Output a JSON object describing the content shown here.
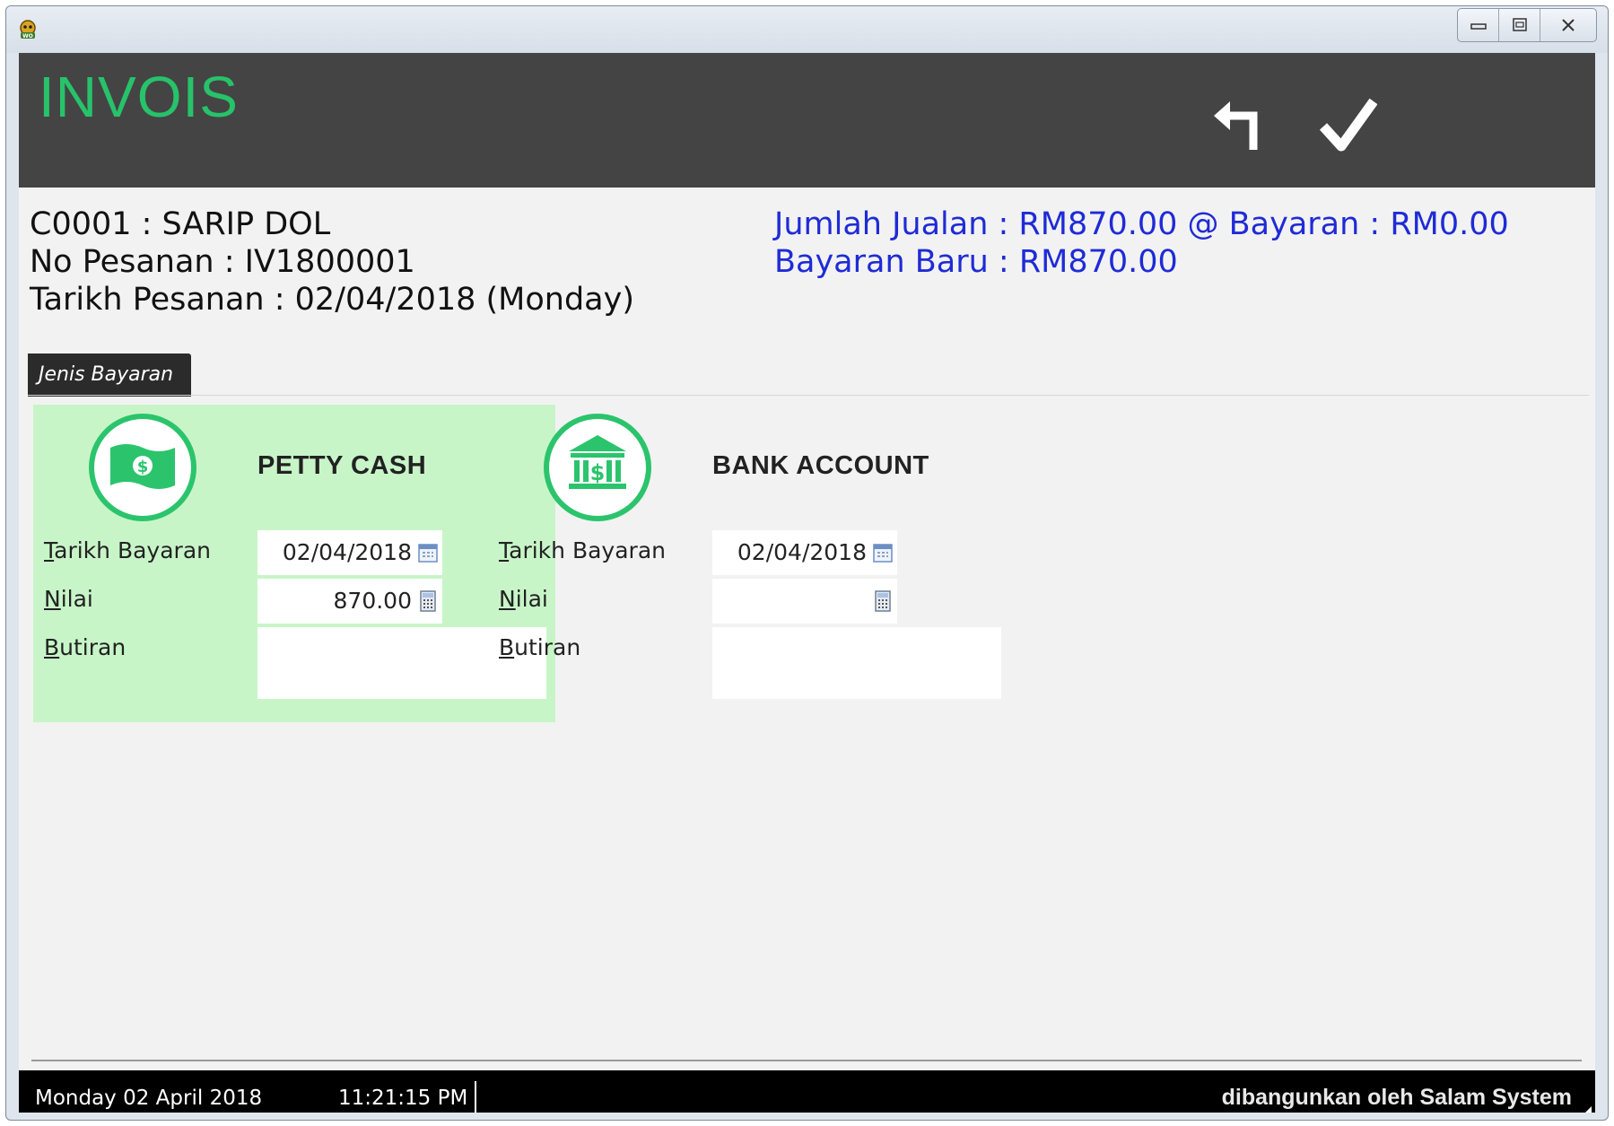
{
  "window": {
    "controls": {
      "minimize": "minimize",
      "restore": "restore",
      "close": "close"
    }
  },
  "header": {
    "title": "INVOIS",
    "back_icon": "back-arrow-icon",
    "confirm_icon": "checkmark-icon",
    "accent_color": "#27c26a",
    "background_color": "#444444"
  },
  "info": {
    "customer": "C0001 : SARIP DOL",
    "order_no": "No Pesanan : IV1800001",
    "order_date": "Tarikh Pesanan : 02/04/2018 (Monday)",
    "totals": "Jumlah Jualan : RM870.00 @ Bayaran : RM0.00",
    "new_payment": "Bayaran Baru : RM870.00",
    "totals_color": "#1f2bd6"
  },
  "tab": {
    "label": "Jenis Bayaran"
  },
  "payments": [
    {
      "title": "PETTY CASH",
      "icon": "cash-icon",
      "selected": true,
      "date_label_first": "T",
      "date_label_rest": "arikh Bayaran",
      "date_value": "02/04/2018",
      "amount_label_first": "N",
      "amount_label_rest": "ilai",
      "amount_value": "870.00",
      "details_label_first": "B",
      "details_label_rest": "utiran",
      "details_value": ""
    },
    {
      "title": "BANK ACCOUNT",
      "icon": "bank-icon",
      "selected": false,
      "date_label_first": "T",
      "date_label_rest": "arikh Bayaran",
      "date_value": "02/04/2018",
      "amount_label_first": "N",
      "amount_label_rest": "ilai",
      "amount_value": "",
      "details_label_first": "B",
      "details_label_rest": "utiran",
      "details_value": ""
    }
  ],
  "status": {
    "date": "Monday 02 April 2018",
    "time": "11:21:15 PM",
    "credit": "dibangunkan oleh Salam System"
  }
}
